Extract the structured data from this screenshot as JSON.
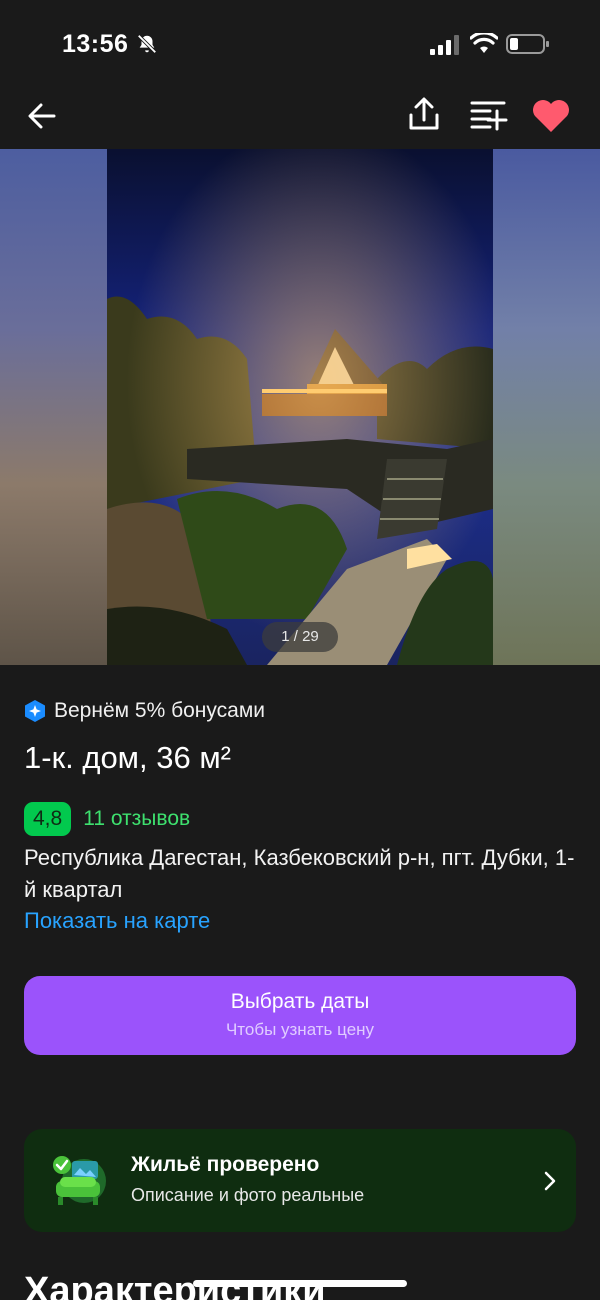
{
  "status_bar": {
    "time": "13:56"
  },
  "gallery": {
    "counter": "1 / 29"
  },
  "bonus": {
    "text": "Вернём 5% бонусами"
  },
  "listing": {
    "title": "1-к. дом, 36 м²",
    "rating": "4,8",
    "reviews": "11 отзывов",
    "address": "Республика Дагестан, Казбековский р-н, пгт. Дубки, 1-й квартал",
    "map_link": "Показать на карте"
  },
  "dates_button": {
    "label": "Выбрать даты",
    "sublabel": "Чтобы узнать цену"
  },
  "verified": {
    "title": "Жильё проверено",
    "subtitle": "Описание и фото реальные"
  },
  "section": {
    "heading": "Характеристики"
  },
  "colors": {
    "background": "#1a1a1a",
    "accent_purple": "#9b53fb",
    "rating_green": "#02c94e",
    "link_blue": "#28a3ff",
    "favorite_red": "#ff5a6e",
    "verified_bg": "#0f2d10"
  },
  "icons": [
    "bell-muted-icon",
    "signal-icon",
    "wifi-icon",
    "battery-icon",
    "back-arrow-icon",
    "share-icon",
    "compare-icon",
    "heart-icon",
    "bonus-icon",
    "verified-home-icon",
    "chevron-right-icon"
  ]
}
